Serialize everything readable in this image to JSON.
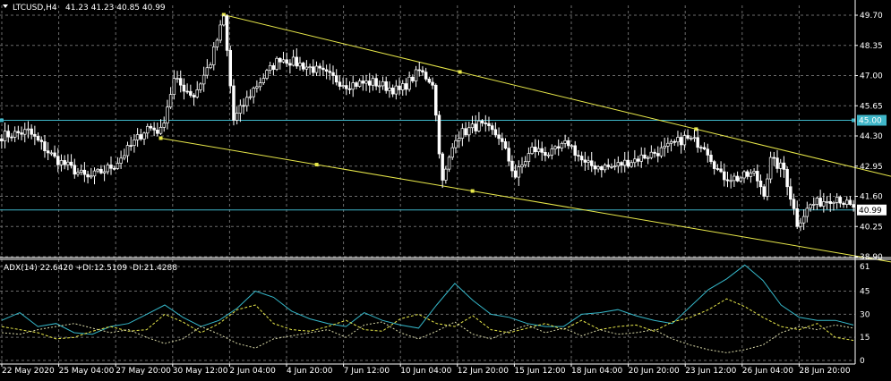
{
  "header": {
    "symbol": "LTCUSD,H4",
    "ohlc": "41.23 41.23 40.85 40.99"
  },
  "indicator": {
    "label": "ADX(14) 22.6420 +DI:12.5109 -DI:21.4288"
  },
  "colors": {
    "background": "#000000",
    "grid": "#6b6b6b",
    "candle": "#ffffff",
    "bull_body": "#000000",
    "bear_body": "#ffffff",
    "trendline": "#e8e84a",
    "hline": "#3fb6c8",
    "adx": "#35b7c9",
    "plus_di": "#e8e84a",
    "minus_di": "#d8d8a8",
    "text": "#ffffff"
  },
  "chart_data": [
    {
      "type": "candlestick",
      "title": "LTCUSD,H4",
      "ylim": [
        38.9,
        50.3
      ],
      "y_ticks": [
        "49.70",
        "48.35",
        "47.00",
        "45.65",
        "44.30",
        "42.95",
        "41.60",
        "40.25",
        "38.90"
      ],
      "x_ticks": [
        "22 May 2020",
        "25 May 04:00",
        "27 May 20:00",
        "30 May 12:00",
        "2 Jun 04:00",
        "4 Jun 20:00",
        "7 Jun 12:00",
        "10 Jun 04:00",
        "12 Jun 20:00",
        "15 Jun 12:00",
        "18 Jun 04:00",
        "20 Jun 20:00",
        "23 Jun 12:00",
        "26 Jun 04:00",
        "28 Jun 20:00"
      ],
      "price_badges": [
        "45.00",
        "40.99"
      ],
      "anchors": [
        {
          "t": 0,
          "p": 44.3
        },
        {
          "t": 8,
          "p": 44.5
        },
        {
          "t": 16,
          "p": 43.3
        },
        {
          "t": 26,
          "p": 42.4
        },
        {
          "t": 34,
          "p": 43.0
        },
        {
          "t": 44,
          "p": 44.7
        },
        {
          "t": 48,
          "p": 44.5
        },
        {
          "t": 52,
          "p": 46.8
        },
        {
          "t": 58,
          "p": 46.1
        },
        {
          "t": 63,
          "p": 47.6
        },
        {
          "t": 67,
          "p": 49.6
        },
        {
          "t": 70,
          "p": 45.0
        },
        {
          "t": 76,
          "p": 46.4
        },
        {
          "t": 84,
          "p": 47.8
        },
        {
          "t": 94,
          "p": 47.3
        },
        {
          "t": 104,
          "p": 46.6
        },
        {
          "t": 112,
          "p": 46.7
        },
        {
          "t": 120,
          "p": 46.3
        },
        {
          "t": 126,
          "p": 47.2
        },
        {
          "t": 130,
          "p": 46.7
        },
        {
          "t": 133,
          "p": 42.2
        },
        {
          "t": 137,
          "p": 44.3
        },
        {
          "t": 144,
          "p": 44.8
        },
        {
          "t": 150,
          "p": 44.3
        },
        {
          "t": 155,
          "p": 42.5
        },
        {
          "t": 160,
          "p": 43.7
        },
        {
          "t": 166,
          "p": 43.5
        },
        {
          "t": 171,
          "p": 44.0
        },
        {
          "t": 176,
          "p": 43.0
        },
        {
          "t": 184,
          "p": 42.9
        },
        {
          "t": 192,
          "p": 43.3
        },
        {
          "t": 200,
          "p": 43.7
        },
        {
          "t": 206,
          "p": 44.2
        },
        {
          "t": 212,
          "p": 43.9
        },
        {
          "t": 217,
          "p": 42.5
        },
        {
          "t": 222,
          "p": 42.4
        },
        {
          "t": 227,
          "p": 42.6
        },
        {
          "t": 230,
          "p": 41.8
        },
        {
          "t": 232,
          "p": 43.2
        },
        {
          "t": 236,
          "p": 42.8
        },
        {
          "t": 240,
          "p": 40.4
        },
        {
          "t": 244,
          "p": 41.2
        },
        {
          "t": 252,
          "p": 41.6
        },
        {
          "t": 257,
          "p": 40.99
        }
      ],
      "trendlines": [
        {
          "t1": 67,
          "p1": 49.72,
          "t2": 257,
          "p2": 42.9
        },
        {
          "t1": 48,
          "p1": 44.2,
          "t2": 257,
          "p2": 38.95
        }
      ],
      "horizontal_lines": [
        45.0,
        40.99
      ]
    },
    {
      "type": "line",
      "title": "ADX(14) 22.6420 +DI:12.5109 -DI:21.4288",
      "ylim": [
        0,
        63
      ],
      "y_ticks": [
        "61",
        "45",
        "30",
        "15",
        "0"
      ],
      "series": [
        {
          "name": "ADX(14)",
          "values": [
            26,
            31,
            22,
            24,
            18,
            17,
            22,
            24,
            30,
            36,
            28,
            22,
            26,
            34,
            45,
            41,
            32,
            27,
            24,
            22,
            31,
            26,
            23,
            21,
            36,
            50,
            39,
            30,
            28,
            24,
            22,
            22,
            30,
            31,
            33,
            29,
            26,
            24,
            35,
            46,
            53,
            62,
            52,
            36,
            28,
            26,
            26,
            23
          ]
        },
        {
          "name": "+DI",
          "values": [
            22,
            20,
            18,
            14,
            15,
            19,
            22,
            19,
            20,
            30,
            25,
            18,
            24,
            33,
            36,
            24,
            20,
            19,
            22,
            26,
            20,
            19,
            27,
            30,
            24,
            22,
            29,
            20,
            18,
            21,
            24,
            20,
            26,
            20,
            22,
            23,
            19,
            25,
            28,
            33,
            40,
            35,
            28,
            22,
            20,
            24,
            15,
            13
          ]
        },
        {
          "name": "-DI",
          "values": [
            18,
            17,
            20,
            22,
            24,
            21,
            18,
            20,
            15,
            11,
            14,
            22,
            17,
            11,
            8,
            14,
            16,
            18,
            20,
            15,
            23,
            25,
            18,
            14,
            19,
            25,
            17,
            14,
            19,
            23,
            18,
            21,
            16,
            20,
            17,
            18,
            20,
            14,
            10,
            7,
            5,
            7,
            10,
            18,
            22,
            20,
            23,
            21
          ]
        }
      ]
    }
  ]
}
